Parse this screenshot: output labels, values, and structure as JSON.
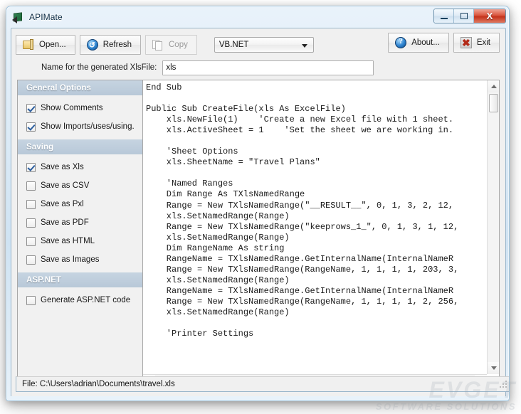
{
  "window": {
    "title": "APIMate",
    "icon": "excel-sheet-icon",
    "buttons": {
      "minimize": "–",
      "maximize": "□",
      "close": "X"
    }
  },
  "toolbar": {
    "open_label": "Open...",
    "refresh_label": "Refresh",
    "copy_label": "Copy",
    "language_selected": "VB.NET",
    "about_label": "About...",
    "exit_label": "Exit"
  },
  "filename_row": {
    "label": "Name for the generated XlsFile:",
    "value": "xls",
    "placeholder": ""
  },
  "sidebar": {
    "sections": [
      {
        "title": "General Options",
        "items": [
          {
            "label": "Show Comments",
            "checked": true
          },
          {
            "label": "Show Imports/uses/using.",
            "checked": true
          }
        ]
      },
      {
        "title": "Saving",
        "items": [
          {
            "label": "Save as Xls",
            "checked": true
          },
          {
            "label": "Save as CSV",
            "checked": false
          },
          {
            "label": "Save as Pxl",
            "checked": false
          },
          {
            "label": "Save as PDF",
            "checked": false
          },
          {
            "label": "Save as HTML",
            "checked": false
          },
          {
            "label": "Save as Images",
            "checked": false
          }
        ]
      },
      {
        "title": "ASP.NET",
        "items": [
          {
            "label": "Generate ASP.NET code",
            "checked": false
          }
        ]
      }
    ]
  },
  "code": {
    "text": "End Sub\n\nPublic Sub CreateFile(xls As ExcelFile)\n    xls.NewFile(1)    'Create a new Excel file with 1 sheet.\n    xls.ActiveSheet = 1    'Set the sheet we are working in.\n\n    'Sheet Options\n    xls.SheetName = \"Travel Plans\"\n\n    'Named Ranges\n    Dim Range As TXlsNamedRange\n    Range = New TXlsNamedRange(\"__RESULT__\", 0, 1, 3, 2, 12,\n    xls.SetNamedRange(Range)\n    Range = New TXlsNamedRange(\"keeprows_1_\", 0, 1, 3, 1, 12,\n    xls.SetNamedRange(Range)\n    Dim RangeName As string\n    RangeName = TXlsNamedRange.GetInternalName(InternalNameR\n    Range = New TXlsNamedRange(RangeName, 1, 1, 1, 1, 203, 3,\n    xls.SetNamedRange(Range)\n    RangeName = TXlsNamedRange.GetInternalName(InternalNameR\n    Range = New TXlsNamedRange(RangeName, 1, 1, 1, 1, 2, 256,\n    xls.SetNamedRange(Range)\n\n    'Printer Settings"
  },
  "statusbar": {
    "text": "File: C:\\Users\\adrian\\Documents\\travel.xls"
  },
  "watermark": {
    "main": "EVGET",
    "sub": "SOFTWARE SOLUTIONS"
  }
}
